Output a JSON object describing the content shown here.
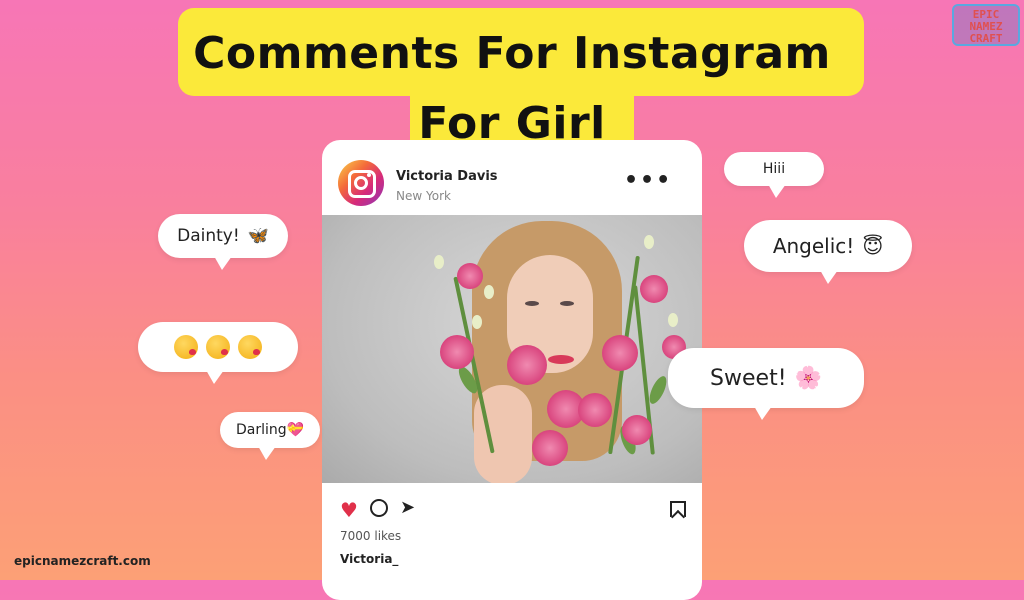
{
  "title": {
    "line1": "Comments For Instagram",
    "line2": "For Girl"
  },
  "logo": {
    "text": "EPIC NAMEZ CRAFT"
  },
  "post": {
    "username": "Victoria Davis",
    "location": "New York",
    "more_label": "•••",
    "likes": "7000 likes",
    "caption_user": "Victoria_"
  },
  "bubbles": {
    "hiii": "Hiii",
    "dainty": "Dainty!",
    "dainty_emoji": "🦋",
    "angelic": "Angelic!",
    "angelic_emoji": "😇",
    "sweet": "Sweet!",
    "sweet_emoji": "🌸",
    "darling": "Darling",
    "darling_emoji": "💝"
  },
  "footer": {
    "url": "epicnamezcraft.com"
  },
  "colors": {
    "title_bg": "#fbe93a",
    "heart": "#e0304a",
    "background_top": "#f776b6",
    "background_bottom": "#fca076"
  }
}
